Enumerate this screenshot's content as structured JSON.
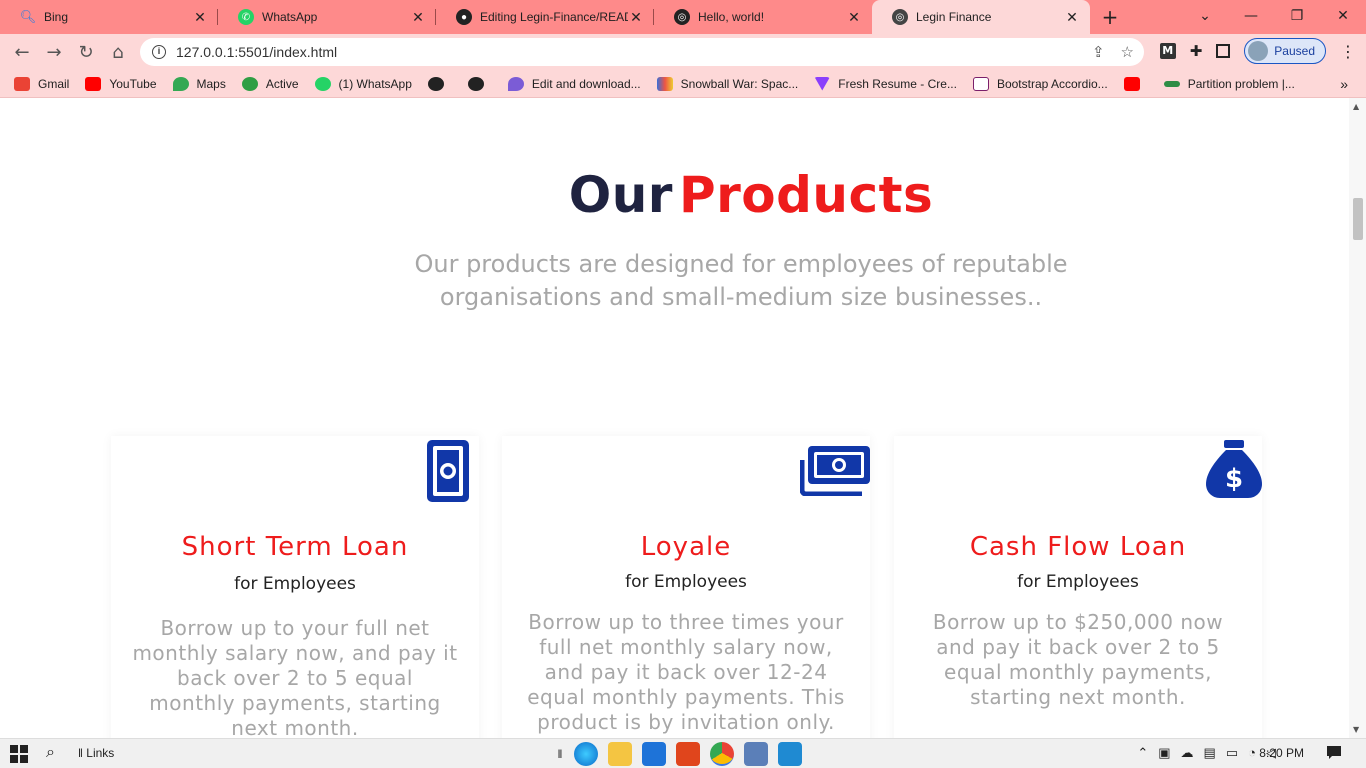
{
  "browser": {
    "tabs": [
      {
        "label": "Bing",
        "color": "#2a7de1"
      },
      {
        "label": "WhatsApp",
        "color": "#25d366"
      },
      {
        "label": "Editing Legin-Finance/READM",
        "color": "#222222"
      },
      {
        "label": "Hello, world!",
        "color": "#222222"
      },
      {
        "label": "Legin Finance",
        "color": "#444444"
      }
    ],
    "new_tab": "+",
    "url": "127.0.0.1:5501/index.html",
    "profile_status": "Paused",
    "bookmarks": [
      {
        "label": "Gmail",
        "color": "#ea4335"
      },
      {
        "label": "YouTube",
        "color": "#ff0000"
      },
      {
        "label": "Maps",
        "color": "#34a853"
      },
      {
        "label": "Active",
        "color": "#2f9e44"
      },
      {
        "label": "(1) WhatsApp",
        "color": "#25d366"
      },
      {
        "label": "",
        "color": "#222222"
      },
      {
        "label": "",
        "color": "#222222"
      },
      {
        "label": "Edit and download...",
        "color": "#7b5cd6"
      },
      {
        "label": "Snowball War: Spac...",
        "color": "#3b6fd8"
      },
      {
        "label": "Fresh Resume - Cre...",
        "color": "#8a3ffc"
      },
      {
        "label": "Bootstrap Accordio...",
        "color": "#7a1f6a"
      },
      {
        "label": "",
        "color": "#ff0000"
      },
      {
        "label": "Partition problem |...",
        "color": "#2f8d46"
      }
    ]
  },
  "page": {
    "heading_a": "Our",
    "heading_b": "Products",
    "subtitle": "Our products are designed for employees of reputable organisations and small-medium size businesses..",
    "accent_color": "#ee1c1c",
    "icon_color": "#1137a8",
    "cards": [
      {
        "title": "Short Term Loan",
        "subtitle": "for Employees",
        "body": "Borrow up to your full net monthly salary now, and pay it back over 2 to 5 equal monthly payments, starting next month.",
        "icon": "money-bill-icon"
      },
      {
        "title": "Loyale",
        "subtitle": "for Employees",
        "body": "Borrow up to three times your full net monthly salary now, and pay it back over 12-24 equal monthly payments. This product is by invitation only. Find Out",
        "icon": "money-bills-icon"
      },
      {
        "title": "Cash Flow Loan",
        "subtitle": "for Employees",
        "body": "Borrow up to $250,000 now and pay it back over 2 to 5 equal monthly payments, starting next month.",
        "icon": "money-bag-icon"
      }
    ]
  },
  "taskbar": {
    "links_label": "Links",
    "time": "8:20 PM"
  }
}
